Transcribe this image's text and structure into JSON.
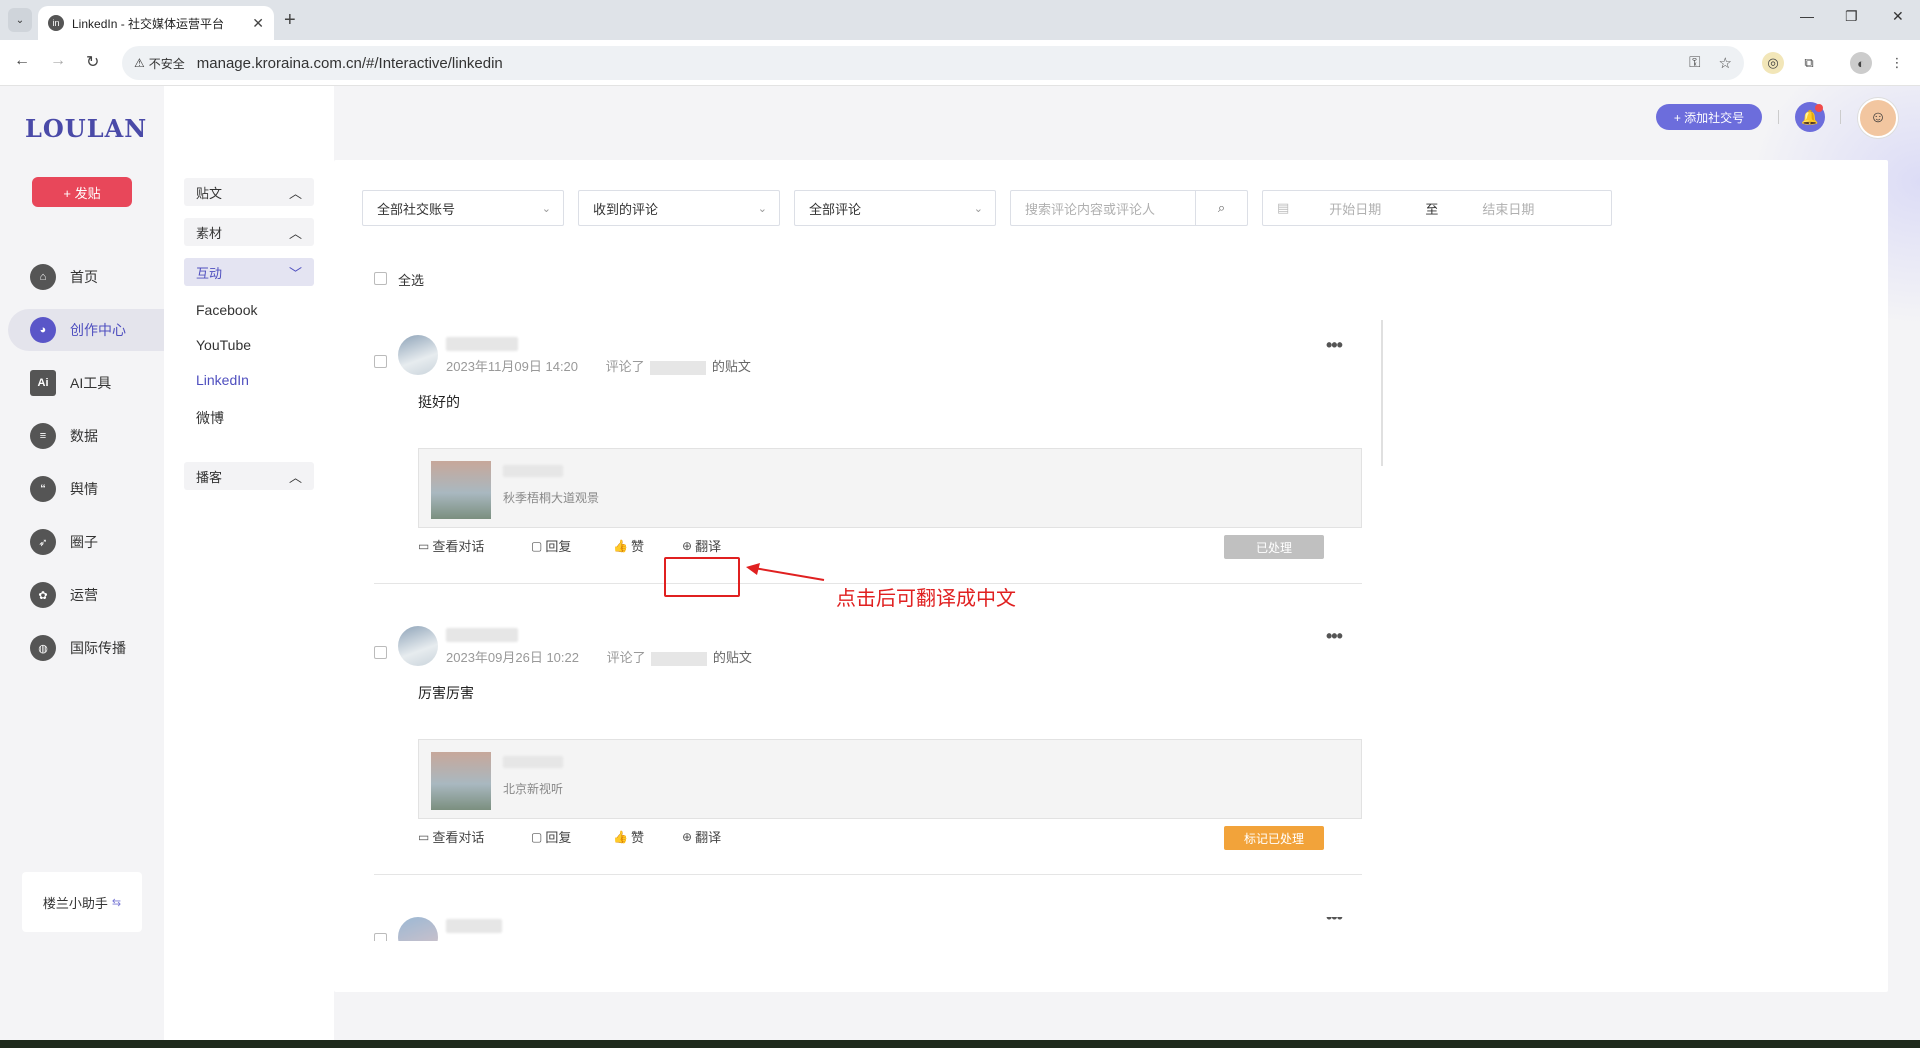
{
  "browser": {
    "tab_title": "LinkedIn - 社交媒体运营平台",
    "insecure_label": "不安全",
    "url": "manage.kroraina.com.cn/#/Interactive/linkedin"
  },
  "app": {
    "logo": "LOULAN",
    "post_button": "+ 发贴",
    "add_social_button": "+ 添加社交号",
    "nav": [
      {
        "label": "首页",
        "icon": "home-icon"
      },
      {
        "label": "创作中心",
        "icon": "palette-icon",
        "active": true
      },
      {
        "label": "AI工具",
        "icon": "ai-icon"
      },
      {
        "label": "数据",
        "icon": "database-icon"
      },
      {
        "label": "舆情",
        "icon": "quote-icon"
      },
      {
        "label": "圈子",
        "icon": "compass-icon"
      },
      {
        "label": "运营",
        "icon": "operations-icon"
      },
      {
        "label": "国际传播",
        "icon": "globe-icon"
      }
    ],
    "helper": "楼兰小助手"
  },
  "submenu": {
    "posts": "贴文",
    "materials": "素材",
    "interaction": "互动",
    "links": [
      "Facebook",
      "YouTube",
      "LinkedIn",
      "微博"
    ],
    "podcast": "播客"
  },
  "filters": {
    "accounts": "全部社交账号",
    "received": "收到的评论",
    "all_comments": "全部评论",
    "search_placeholder": "搜索评论内容或评论人",
    "start_date": "开始日期",
    "to": "至",
    "end_date": "结束日期",
    "select_all": "全选"
  },
  "comments": [
    {
      "time": "2023年11月09日 14:20",
      "commented": "评论了",
      "post_suffix": "的贴文",
      "text": "挺好的",
      "post_subtitle": "秋季梧桐大道观景",
      "status": "已处理"
    },
    {
      "time": "2023年09月26日 10:22",
      "commented": "评论了",
      "post_suffix": "的贴文",
      "text": "厉害厉害",
      "post_subtitle": "北京新视听",
      "status": "标记已处理"
    }
  ],
  "actions": {
    "view_conversation": "查看对话",
    "reply": "回复",
    "like": "赞",
    "translate": "翻译"
  },
  "annotation": "点击后可翻译成中文",
  "colors": {
    "brand": "#6c6ddc",
    "post_button": "#e8475a",
    "annotation": "#e02020",
    "mark_button": "#f2a33a"
  }
}
